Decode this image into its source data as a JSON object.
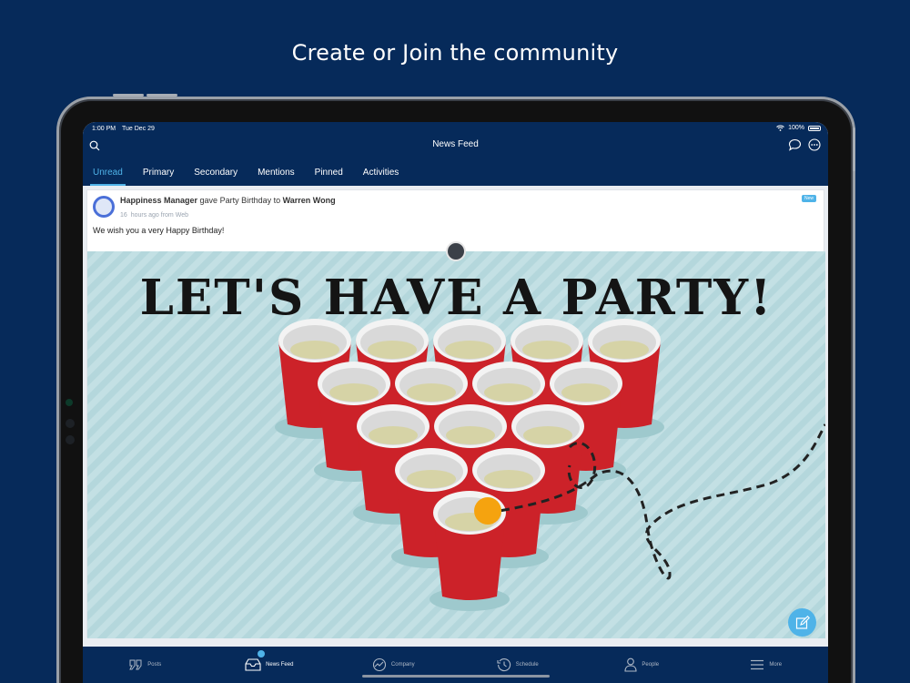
{
  "headline": "Create or Join the community",
  "status": {
    "time": "1:00 PM",
    "date": "Tue Dec 29",
    "battery": "100%"
  },
  "header": {
    "title": "News Feed"
  },
  "tabs": [
    {
      "label": "Unread",
      "active": true
    },
    {
      "label": "Primary",
      "active": false
    },
    {
      "label": "Secondary",
      "active": false
    },
    {
      "label": "Mentions",
      "active": false
    },
    {
      "label": "Pinned",
      "active": false
    },
    {
      "label": "Activities",
      "active": false
    }
  ],
  "post": {
    "author": "Happiness Manager",
    "action": "gave Party Birthday to",
    "recipient": "Warren Wong",
    "time_count": "16",
    "time_rest": "hours ago from Web",
    "badge": "New",
    "message": "We wish you a very Happy Birthday!",
    "image_text": "LET'S HAVE A PARTY!"
  },
  "bottom_nav": [
    {
      "label": "Posts",
      "icon": "quote-icon",
      "active": false
    },
    {
      "label": "News Feed",
      "icon": "inbox-icon",
      "active": true
    },
    {
      "label": "Company",
      "icon": "company-icon",
      "active": false
    },
    {
      "label": "Schedule",
      "icon": "history-icon",
      "active": false
    },
    {
      "label": "People",
      "icon": "person-icon",
      "active": false
    },
    {
      "label": "More",
      "icon": "menu-icon",
      "active": false
    }
  ],
  "colors": {
    "brand_navy": "#062a5a",
    "accent_blue": "#4fb3e8",
    "cup_red": "#cc2229",
    "ball_orange": "#f5a30f",
    "pattern_bg": "#bfdfe3"
  }
}
